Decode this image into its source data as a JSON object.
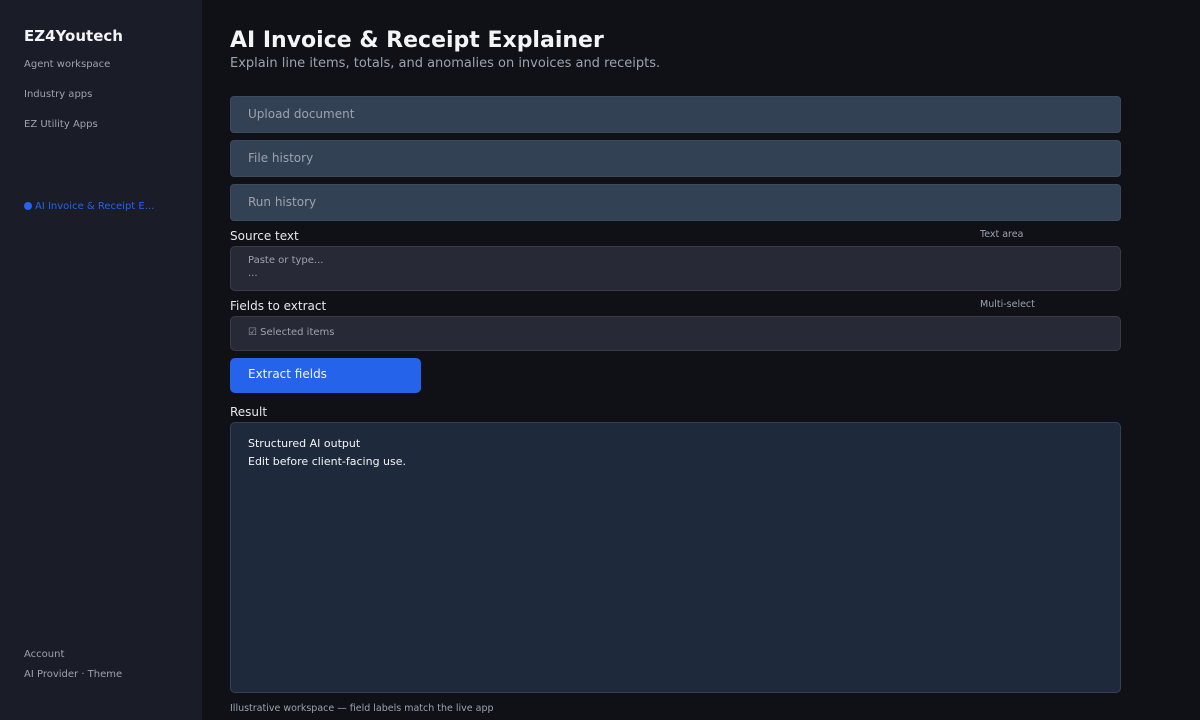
{
  "sidebar": {
    "brand": "EZ4Youtech",
    "nav": [
      {
        "label": "Agent workspace"
      },
      {
        "label": "Industry apps"
      },
      {
        "label": "EZ Utility Apps"
      }
    ],
    "active_app": "AI Invoice & Receipt E...",
    "footer": {
      "account": "Account",
      "settings": "AI Provider · Theme"
    }
  },
  "main": {
    "title": "AI Invoice & Receipt Explainer",
    "subtitle": "Explain line items, totals, and anomalies on invoices and receipts.",
    "sections": [
      {
        "label": "Upload document"
      },
      {
        "label": "File history"
      },
      {
        "label": "Run history"
      }
    ],
    "source": {
      "label": "Source text",
      "hint": "Text area",
      "placeholder": "Paste or type...",
      "continuation": "..."
    },
    "fields": {
      "label": "Fields to extract",
      "hint": "Multi-select",
      "value": "☑ Selected items"
    },
    "action_button": "Extract fields",
    "result": {
      "label": "Result",
      "line1": "Structured AI output",
      "line2": "Edit before client-facing use."
    },
    "footer_note": "Illustrative workspace — field labels match the live app"
  },
  "colors": {
    "background": "#0f1117",
    "sidebar": "#1a1c27",
    "accent": "#2563eb",
    "panel": "#334155",
    "result_bg": "#1e293b"
  }
}
